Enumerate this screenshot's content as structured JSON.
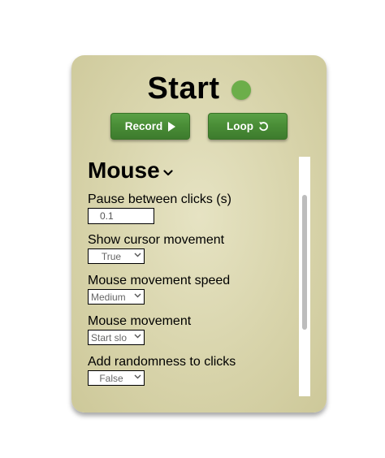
{
  "header": {
    "title": "Start",
    "status_color": "#6cae4a"
  },
  "buttons": {
    "record_label": "Record",
    "record_icon": "play-icon",
    "loop_label": "Loop",
    "loop_icon": "loop-icon"
  },
  "section": {
    "title": "Mouse",
    "expanded": true
  },
  "settings": [
    {
      "label": "Pause between clicks (s)",
      "type": "input",
      "value": "0.1"
    },
    {
      "label": "Show cursor movement",
      "type": "select",
      "value": "True"
    },
    {
      "label": "Mouse movement speed",
      "type": "select",
      "value": "Medium"
    },
    {
      "label": "Mouse movement",
      "type": "select",
      "value": "Start slo"
    },
    {
      "label": "Add randomness to clicks",
      "type": "select",
      "value": "False"
    }
  ],
  "colors": {
    "panel": "#d8d4ab",
    "button": "#4a8e37"
  }
}
